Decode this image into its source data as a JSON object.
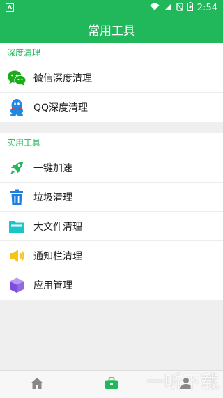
{
  "status_bar": {
    "time": "2:54",
    "left_icon": "A",
    "icons": [
      "wifi-icon",
      "signal-icon",
      "no-sim-icon",
      "battery-charging-icon"
    ]
  },
  "app_bar": {
    "title": "常用工具"
  },
  "sections": [
    {
      "title": "深度清理",
      "items": [
        {
          "label": "微信深度清理",
          "icon": "wechat-icon"
        },
        {
          "label": "QQ深度清理",
          "icon": "qq-icon"
        }
      ]
    },
    {
      "title": "实用工具",
      "items": [
        {
          "label": "一键加速",
          "icon": "rocket-icon"
        },
        {
          "label": "垃圾清理",
          "icon": "trash-icon"
        },
        {
          "label": "大文件清理",
          "icon": "folder-icon"
        },
        {
          "label": "通知栏清理",
          "icon": "speaker-icon"
        },
        {
          "label": "应用管理",
          "icon": "box-icon"
        }
      ]
    }
  ],
  "bottom_nav": [
    {
      "icon": "home-icon",
      "active": false
    },
    {
      "icon": "toolbox-icon",
      "active": true
    },
    {
      "icon": "profile-icon",
      "active": false
    }
  ],
  "watermark": {
    "text": "一听下载"
  },
  "colors": {
    "accent": "#21b85b",
    "background": "#efefef"
  }
}
